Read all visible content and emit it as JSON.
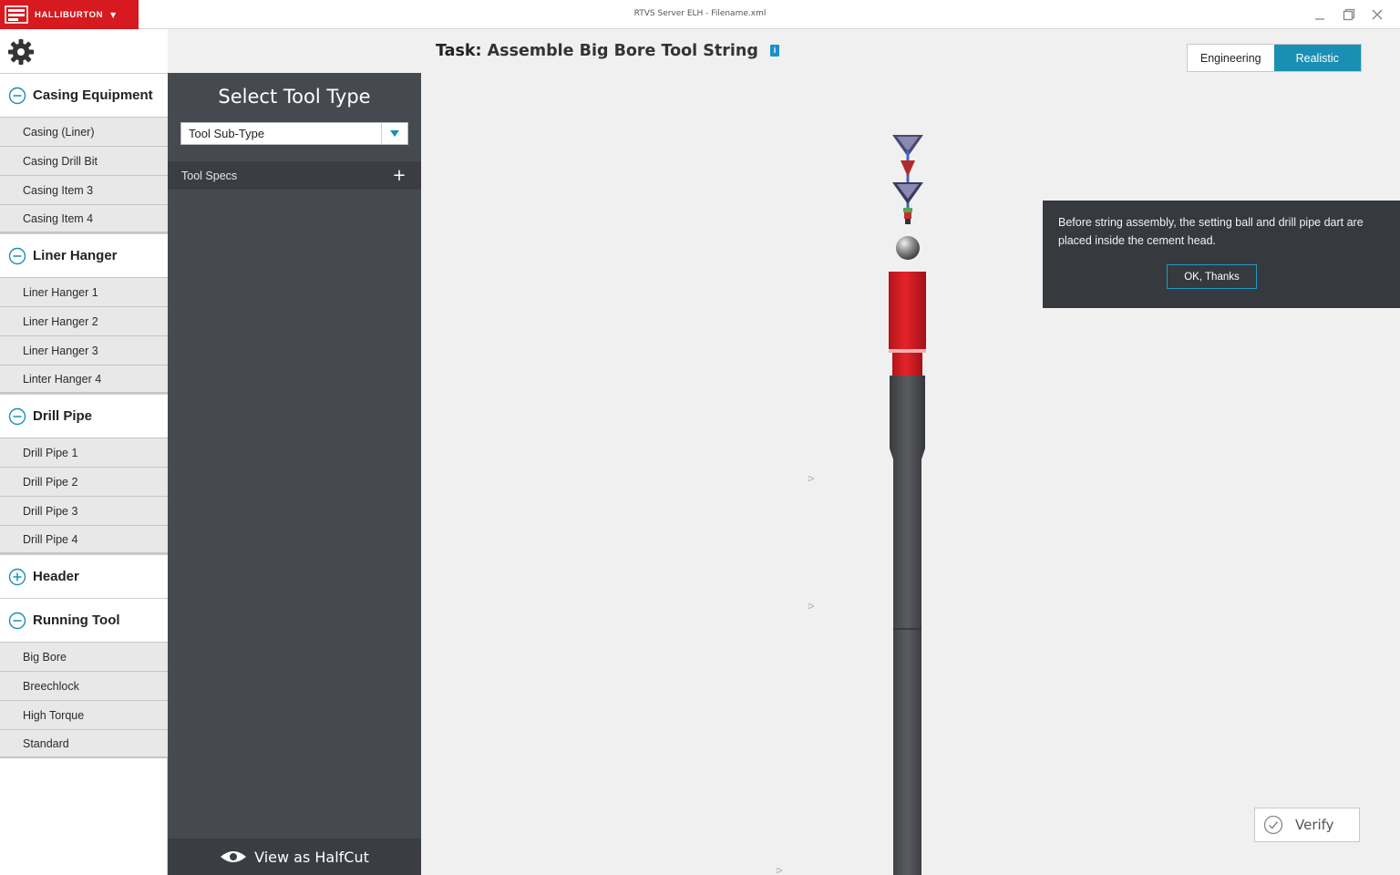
{
  "titlebar": {
    "brand": "HALLIBURTON",
    "window_title": "RTVS Server ELH - Filename.xml"
  },
  "sidebar": {
    "categories": [
      {
        "label": "Casing Equipment",
        "state": "collapse",
        "items": [
          "Casing (Liner)",
          "Casing Drill Bit",
          "Casing Item 3",
          "Casing Item 4"
        ]
      },
      {
        "label": "Liner Hanger",
        "state": "collapse",
        "items": [
          "Liner Hanger 1",
          "Liner Hanger 2",
          "Liner Hanger 3",
          "Linter Hanger 4"
        ]
      },
      {
        "label": "Drill Pipe",
        "state": "collapse",
        "items": [
          "Drill Pipe 1",
          "Drill Pipe 2",
          "Drill Pipe 3",
          "Drill Pipe 4"
        ]
      },
      {
        "label": "Header",
        "state": "expand",
        "items": []
      },
      {
        "label": "Running Tool",
        "state": "collapse",
        "items": [
          "Big Bore",
          "Breechlock",
          "High Torque",
          "Standard"
        ]
      }
    ]
  },
  "panel": {
    "title": "Select Tool Type",
    "subtype_value": "Tool Sub-Type",
    "specs_label": "Tool Specs",
    "halfcut_label": "View as HalfCut"
  },
  "main": {
    "task_prefix": "Task:",
    "task_name": "Assemble Big Bore Tool String",
    "view_modes": {
      "engineering": "Engineering",
      "realistic": "Realistic",
      "selected": "Realistic"
    },
    "tooltip": {
      "text": "Before string assembly, the setting ball and drill pipe dart are placed inside the cement head.",
      "button": "OK, Thanks"
    },
    "verify_label": "Verify"
  },
  "colors": {
    "brand_red": "#d71920",
    "accent_blue": "#1a8fb3",
    "panel_dark": "#464a50",
    "tool_red": "#d81b22",
    "pipe_gray": "#4b4d50"
  }
}
